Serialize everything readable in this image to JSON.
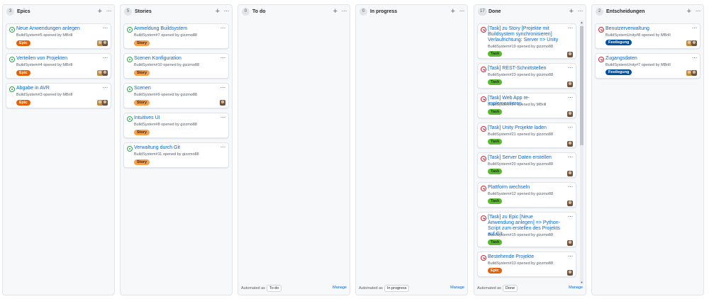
{
  "colors": {
    "epic": "#e36209",
    "story": "#f6a14d",
    "task": "#5cb82e",
    "decision": "#0052a3",
    "link": "#0366d6",
    "open": "#28a745",
    "closed": "#cb2431"
  },
  "columns": [
    {
      "id": "epics",
      "title": "Epics",
      "count": "3",
      "cards": [
        {
          "title": "Neue Anwendungen anlegen",
          "meta": "BuildSystem#5 opened by MBrill",
          "label": "Epic",
          "label_kind": "epic",
          "state": "open",
          "avatars": 2
        },
        {
          "title": "Verteilen von Projekten",
          "meta": "BuildSystem#4 opened by MBrill",
          "label": "Epic",
          "label_kind": "epic",
          "state": "open",
          "avatars": 2
        },
        {
          "title": "Abgabe in AVR",
          "meta": "BuildSystem#3 opened by MBrill",
          "label": "Epic",
          "label_kind": "epic",
          "state": "open",
          "avatars": 2
        }
      ]
    },
    {
      "id": "stories",
      "title": "Stories",
      "count": "5",
      "cards": [
        {
          "title": "Anmeldung Buildsystem",
          "meta": "BuildSystem#7 opened by gizzmo88",
          "label": "Story",
          "label_kind": "story",
          "state": "open",
          "avatars": 0
        },
        {
          "title": "Scenen Konfiguration",
          "meta": "BuildSystem#10 opened by gizzmo88",
          "label": "Story",
          "label_kind": "story",
          "state": "open",
          "avatars": 0
        },
        {
          "title": "Scenen",
          "meta": "BuildSystem#9 opened by gizzmo88",
          "label": "Story",
          "label_kind": "story",
          "state": "open",
          "avatars": 1
        },
        {
          "title": "Intuitives UI",
          "meta": "BuildSystem#8 opened by gizzmo88",
          "label": "Story",
          "label_kind": "story",
          "state": "open",
          "avatars": 0
        },
        {
          "title": "Verwaltung durch Git",
          "meta": "BuildSystem#11 opened by gizzmo88",
          "label": "Story",
          "label_kind": "story",
          "state": "open",
          "avatars": 0
        }
      ]
    },
    {
      "id": "todo",
      "title": "To do",
      "count": "0",
      "cards": [],
      "automated_prefix": "Automated as",
      "automated_value": "To do",
      "manage": "Manage"
    },
    {
      "id": "inprogress",
      "title": "In progress",
      "count": "0",
      "cards": [],
      "automated_prefix": "Automated as",
      "automated_value": "In progress",
      "manage": "Manage"
    },
    {
      "id": "done",
      "title": "Done",
      "count": "17",
      "automated_prefix": "Automated as",
      "automated_value": "Done",
      "manage": "Manage",
      "cards": [
        {
          "title": "[Task] zu Story [Projekte mit Buildsystem synchronisieren] Verlaufrichtung: Server => Unity",
          "meta": "BuildSystem#19 opened by gizzmo88",
          "label": "Task",
          "label_kind": "task",
          "state": "closed",
          "avatars": 1
        },
        {
          "title": "[Task] REST-Schnittstellen",
          "meta": "BuildSystem#23 opened by gizzmo88",
          "label": "Task",
          "label_kind": "task",
          "state": "closed",
          "avatars": 1
        },
        {
          "title": "[Task] Web App re-implementieren",
          "meta": "BuildSystem#24 opened by MBrill",
          "label": "Task",
          "label_kind": "task",
          "state": "closed",
          "avatars": 1
        },
        {
          "title": "[Task] Unity Projekte laden",
          "meta": "BuildSystem#21 opened by gizzmo88",
          "label": "Task",
          "label_kind": "task",
          "state": "closed",
          "avatars": 1
        },
        {
          "title": "[Task] Server Daten erstellen",
          "meta": "BuildSystem#20 opened by gizzmo88",
          "label": "Task",
          "label_kind": "task",
          "state": "closed",
          "avatars": 1
        },
        {
          "title": "Plattform wechseln",
          "meta": "BuildSystem#12 opened by gizzmo88",
          "label": "Task",
          "label_kind": "task",
          "state": "closed",
          "avatars": 1
        },
        {
          "title": "[Task] zu Epic [Neue Anwendung anlegen] => Python-Script zum erstellen des Projekts auf Git",
          "meta": "BuildSystem#15 opened by gizzmo88",
          "label": "Task",
          "label_kind": "task",
          "state": "closed",
          "avatars": 1
        },
        {
          "title": "Bestehende Projekte",
          "meta": "BuildSystem#13 opened by gizzmo88",
          "label": "Epic",
          "label_kind": "epic",
          "state": "closed",
          "avatars": 1
        }
      ]
    },
    {
      "id": "decisions",
      "title": "Entscheidungen",
      "count": "2",
      "cards": [
        {
          "title": "Benutzerverwaltung",
          "meta": "BuildSystemUnity#8 opened by MBrill",
          "label": "Festlegung",
          "label_kind": "decision",
          "state": "closed",
          "avatars": 2
        },
        {
          "title": "Zugangsdaten",
          "meta": "BuildSystemUnity#7 opened by MBrill",
          "label": "Festlegung",
          "label_kind": "decision",
          "state": "closed",
          "avatars": 2
        }
      ]
    }
  ]
}
